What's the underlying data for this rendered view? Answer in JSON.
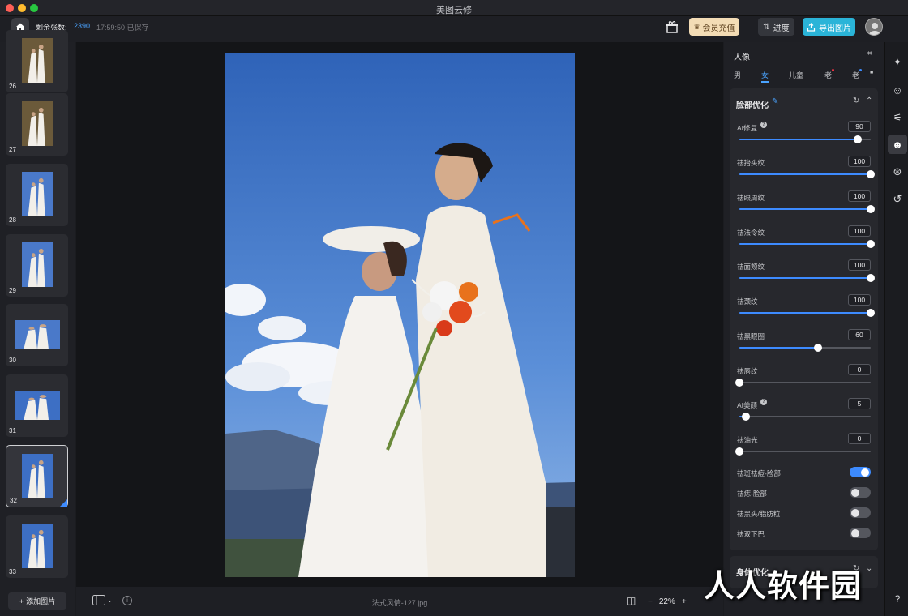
{
  "window": {
    "title": "美图云修"
  },
  "toolbar": {
    "remain_label": "剩余张数:",
    "remain_count": "2390",
    "saved_status": "17:59:50 已保存",
    "vip_label": "会员充值",
    "progress_label": "进度",
    "export_label": "导出图片"
  },
  "thumbnails": [
    {
      "num": "26"
    },
    {
      "num": "27"
    },
    {
      "num": "28"
    },
    {
      "num": "29"
    },
    {
      "num": "30"
    },
    {
      "num": "31"
    },
    {
      "num": "32"
    },
    {
      "num": "33"
    }
  ],
  "left": {
    "add_label": "添加图片"
  },
  "canvas": {
    "filename": "法式风情-127.jpg",
    "zoom": "22%"
  },
  "panel": {
    "section_title": "人像",
    "gender_tabs": [
      "男",
      "女",
      "儿童",
      "老",
      "老"
    ],
    "face_title": "脸部优化",
    "body_title": "身体优化",
    "sliders": [
      {
        "label": "AI修复",
        "value": "90",
        "pct": 0.9
      },
      {
        "label": "祛抬头纹",
        "value": "100",
        "pct": 1.0
      },
      {
        "label": "祛眼周纹",
        "value": "100",
        "pct": 1.0
      },
      {
        "label": "祛法令纹",
        "value": "100",
        "pct": 1.0
      },
      {
        "label": "祛面颊纹",
        "value": "100",
        "pct": 1.0
      },
      {
        "label": "祛颈纹",
        "value": "100",
        "pct": 1.0
      },
      {
        "label": "祛黑眼圈",
        "value": "60",
        "pct": 0.6
      },
      {
        "label": "祛唇纹",
        "value": "0",
        "pct": 0.0
      },
      {
        "label": "AI美颜",
        "value": "5",
        "pct": 0.05
      },
      {
        "label": "祛油光",
        "value": "0",
        "pct": 0.0
      }
    ],
    "toggles": [
      {
        "label": "祛斑祛痘-脸部",
        "on": true
      },
      {
        "label": "祛痣-脸部",
        "on": false
      },
      {
        "label": "祛黑头/脂肪粒",
        "on": false
      },
      {
        "label": "祛双下巴",
        "on": false
      }
    ]
  },
  "watermark": "人人软件园"
}
